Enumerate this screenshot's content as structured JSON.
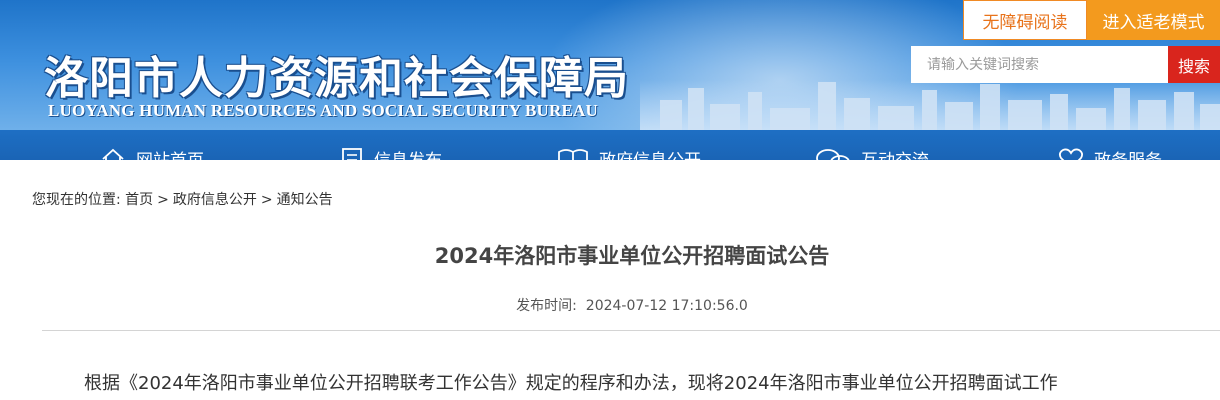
{
  "header": {
    "title": "洛阳市人力资源和社会保障局",
    "subtitle": "LUOYANG HUMAN RESOURCES AND SOCIAL SECURITY BUREAU",
    "accessible_label": "无障碍阅读",
    "elder_mode_label": "进入适老模式",
    "search": {
      "placeholder": "请输入关键词搜索",
      "value": "",
      "button_label": "搜索"
    }
  },
  "nav": {
    "items": [
      {
        "label": "网站首页",
        "icon": "home-icon"
      },
      {
        "label": "信息发布",
        "icon": "document-icon"
      },
      {
        "label": "政府信息公开",
        "icon": "book-icon"
      },
      {
        "label": "互动交流",
        "icon": "chat-icon"
      },
      {
        "label": "政务服务",
        "icon": "heart-icon"
      }
    ]
  },
  "breadcrumb": {
    "prefix": "您现在的位置: ",
    "items": [
      "首页",
      "政府信息公开",
      "通知公告"
    ],
    "separator": ">"
  },
  "article": {
    "title": "2024年洛阳市事业单位公开招聘面试公告",
    "publish_label": "发布时间:",
    "publish_time": "2024-07-12 17:10:56.0",
    "body_first_line": "根据《2024年洛阳市事业单位公开招聘联考工作公告》规定的程序和办法，现将2024年洛阳市事业单位公开招聘面试工作"
  },
  "colors": {
    "header_blue": "#2a7fd4",
    "nav_blue": "#1a64b5",
    "accent_orange": "#f39a1e",
    "search_red": "#d9251d"
  }
}
